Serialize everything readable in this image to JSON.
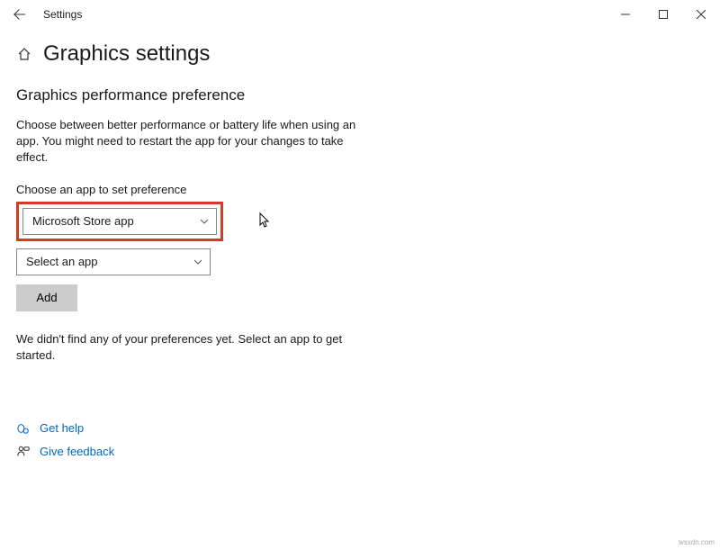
{
  "titlebar": {
    "app_name": "Settings"
  },
  "header": {
    "title": "Graphics settings"
  },
  "section": {
    "heading": "Graphics performance preference",
    "description": "Choose between better performance or battery life when using an app. You might need to restart the app for your changes to take effect.",
    "choose_label": "Choose an app to set preference"
  },
  "dropdowns": {
    "app_type": "Microsoft Store app",
    "app_select": "Select an app"
  },
  "buttons": {
    "add": "Add"
  },
  "status": "We didn't find any of your preferences yet. Select an app to get started.",
  "links": {
    "help": "Get help",
    "feedback": "Give feedback"
  },
  "watermark": "wsxdn.com"
}
